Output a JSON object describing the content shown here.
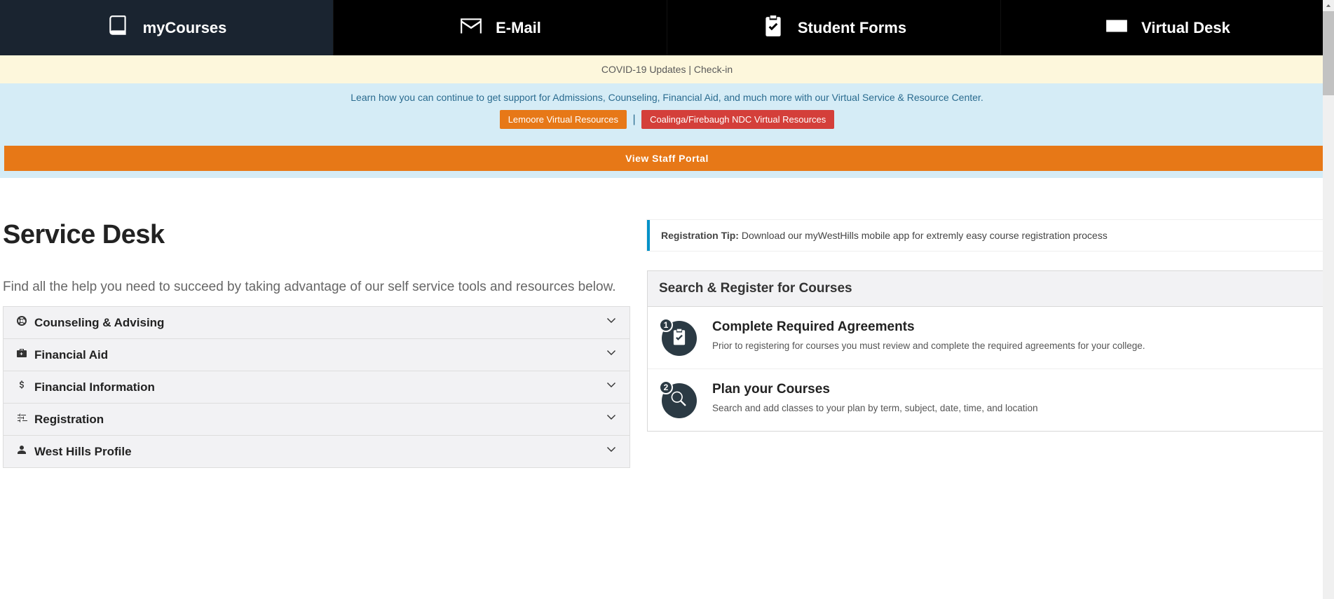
{
  "nav": {
    "items": [
      {
        "label": "myCourses",
        "icon": "book"
      },
      {
        "label": "E-Mail",
        "icon": "mail"
      },
      {
        "label": "Student Forms",
        "icon": "clipboard"
      },
      {
        "label": "Virtual Desk",
        "icon": "keyboard"
      }
    ]
  },
  "covid": {
    "updates": "COVID-19 Updates",
    "sep": " | ",
    "checkin": "Check-in"
  },
  "info": {
    "text": "Learn how you can continue to get support for Admissions, Counseling, Financial Aid, and much more with our Virtual Service & Resource Center.",
    "btn1": "Lemoore Virtual Resources",
    "sep": "|",
    "btn2": "Coalinga/Firebaugh NDC Virtual Resources"
  },
  "staff_portal": "View Staff Portal",
  "service_desk": {
    "title": "Service Desk",
    "sub": "Find all the help you need to succeed by taking advantage of our self service tools and resources below.",
    "items": [
      {
        "label": "Counseling & Advising",
        "icon": "life-ring"
      },
      {
        "label": "Financial Aid",
        "icon": "medkit"
      },
      {
        "label": "Financial Information",
        "icon": "dollar"
      },
      {
        "label": "Registration",
        "icon": "sliders"
      },
      {
        "label": "West Hills Profile",
        "icon": "user"
      }
    ]
  },
  "tip": {
    "bold": "Registration Tip:",
    "text": " Download our myWestHills mobile app for extremly easy course registration process"
  },
  "register": {
    "title": "Search & Register for Courses",
    "steps": [
      {
        "num": "1",
        "title": "Complete Required Agreements",
        "desc": "Prior to registering for courses you must review and complete the required agreements for your college.",
        "icon": "clipboard"
      },
      {
        "num": "2",
        "title": "Plan your Courses",
        "desc": "Search and add classes to your plan by term, subject, date, time, and location",
        "icon": "search"
      }
    ]
  }
}
